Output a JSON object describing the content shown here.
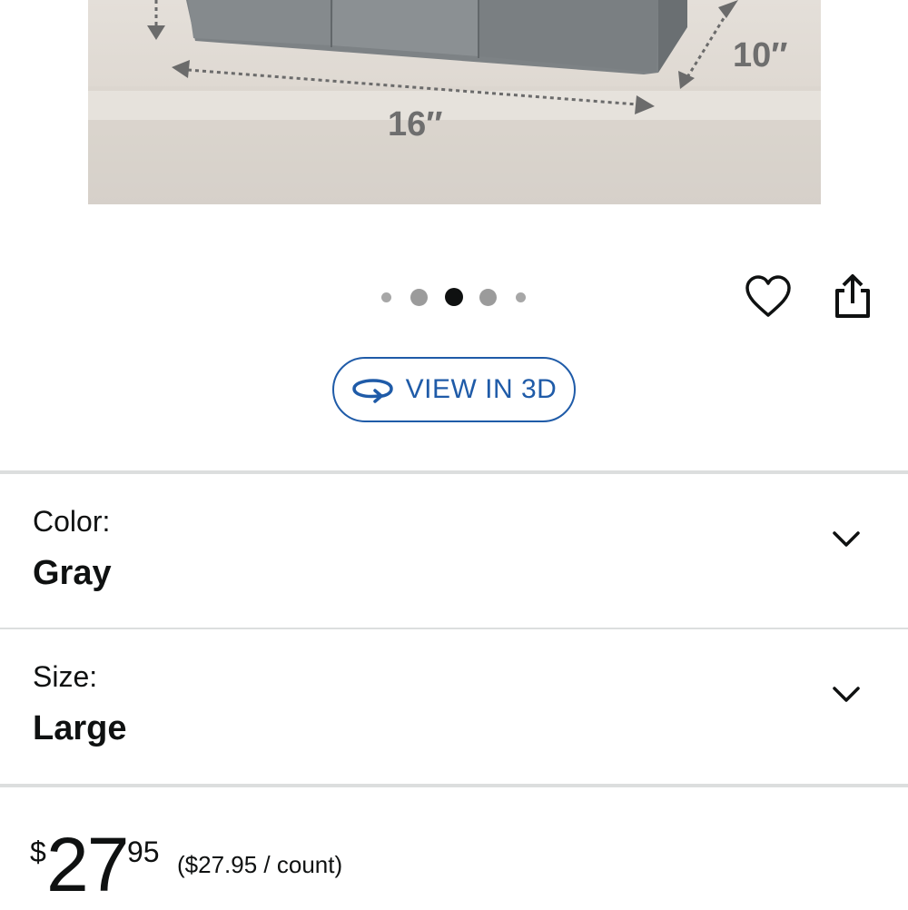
{
  "product_image": {
    "dimension_width": "16″",
    "dimension_depth": "10″",
    "alt": "Gray felt storage bin with dimension arrows"
  },
  "carousel": {
    "total": 5,
    "active_index": 2
  },
  "actions": {
    "favorite_icon": "heart-icon",
    "share_icon": "share-icon"
  },
  "view_3d": {
    "label": "VIEW IN 3D",
    "icon": "rotate-3d-icon",
    "color": "#1f5ba8"
  },
  "variations": [
    {
      "label": "Color:",
      "value": "Gray"
    },
    {
      "label": "Size:",
      "value": "Large"
    }
  ],
  "price": {
    "symbol": "$",
    "whole": "27",
    "fraction": "95",
    "per_unit": "($27.95 / count)"
  }
}
